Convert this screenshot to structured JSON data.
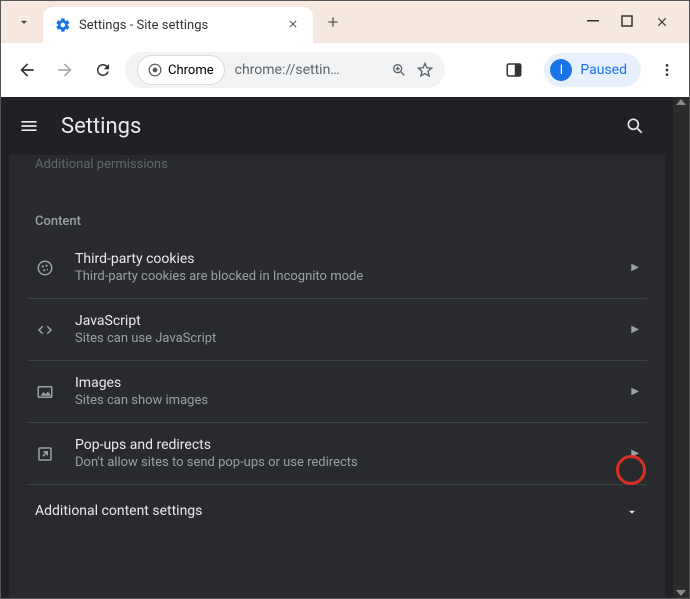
{
  "browser": {
    "tab_title": "Settings - Site settings",
    "address_label": "Chrome",
    "address_url": "chrome://settin…",
    "profile_status": "Paused",
    "profile_initial": "I"
  },
  "header": {
    "title": "Settings"
  },
  "body": {
    "cutoff": "Additional permissions",
    "section_label": "Content",
    "rows": [
      {
        "title": "Third-party cookies",
        "sub": "Third-party cookies are blocked in Incognito mode"
      },
      {
        "title": "JavaScript",
        "sub": "Sites can use JavaScript"
      },
      {
        "title": "Images",
        "sub": "Sites can show images"
      },
      {
        "title": "Pop-ups and redirects",
        "sub": "Don't allow sites to send pop-ups or use redirects"
      }
    ],
    "expand": "Additional content settings"
  }
}
